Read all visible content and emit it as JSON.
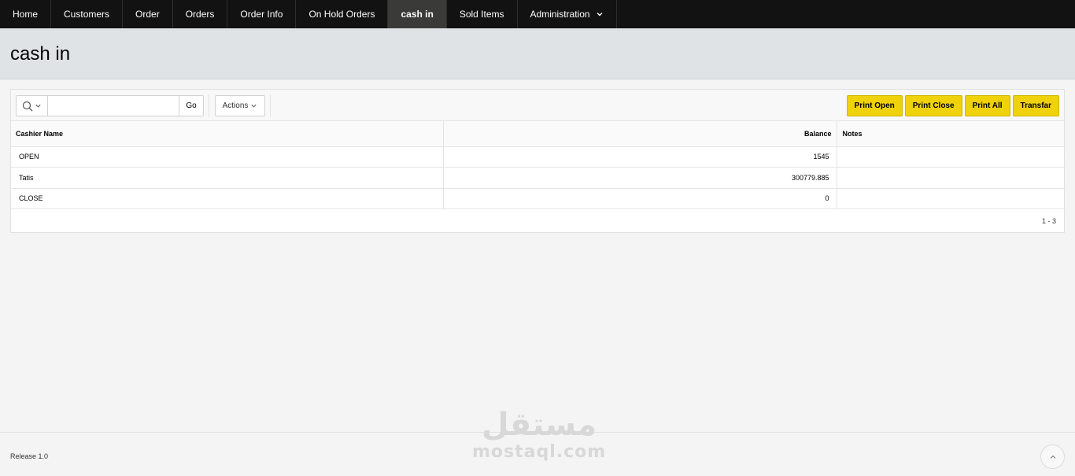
{
  "nav": {
    "items": [
      {
        "label": "Home"
      },
      {
        "label": "Customers"
      },
      {
        "label": "Order"
      },
      {
        "label": "Orders"
      },
      {
        "label": "Order Info"
      },
      {
        "label": "On Hold Orders"
      },
      {
        "label": "cash in"
      },
      {
        "label": "Sold Items"
      },
      {
        "label": "Administration"
      }
    ],
    "active": "cash in"
  },
  "page": {
    "title": "cash in"
  },
  "toolbar": {
    "search_value": "",
    "go_label": "Go",
    "actions_label": "Actions",
    "buttons": {
      "print_open": "Print Open",
      "print_close": "Print Close",
      "print_all": "Print All",
      "transfer": "Transfar"
    }
  },
  "table": {
    "headers": {
      "cashier_name": "Cashier Name",
      "balance": "Balance",
      "notes": "Notes"
    },
    "rows": [
      {
        "cashier_name": "OPEN",
        "balance": "1545",
        "notes": ""
      },
      {
        "cashier_name": "Tatis",
        "balance": "300779.885",
        "notes": ""
      },
      {
        "cashier_name": "CLOSE",
        "balance": "0",
        "notes": ""
      }
    ],
    "pagination": "1 - 3"
  },
  "footer": {
    "release": "Release 1.0"
  },
  "watermark": {
    "arabic": "مستقل",
    "latin": "mostaql.com"
  },
  "colors": {
    "nav_bg": "#121212",
    "nav_active": "#3a3a38",
    "title_bar": "#e0e3e6",
    "button_accent": "#f0d20a"
  }
}
